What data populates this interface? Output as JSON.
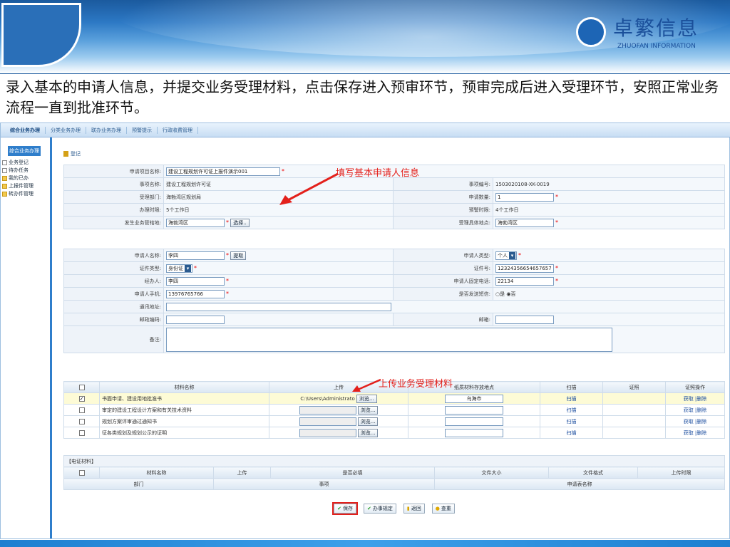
{
  "header": {
    "brand_name": "卓繁信息",
    "brand_sub": "ZHUOFAN INFORMATION"
  },
  "description": "录入基本的申请人信息，并提交业务受理材料，点击保存进入预审环节，预审完成后进入受理环节，安照正常业务流程一直到批准环节。",
  "menubar": [
    "综合业务办理",
    "分类业务办理",
    "联办业务办理",
    "预警提示",
    "行政收费管理"
  ],
  "sidebar": {
    "head": "综合业务办理",
    "items": [
      "业务登记",
      "待办任务",
      "我的已办",
      "上报件管理",
      "转办件管理"
    ]
  },
  "crumb": "登记",
  "annotations": {
    "fill_info": "填写基本申请人信息",
    "upload": "上传业务受理材料"
  },
  "form1": {
    "project_name_label": "申请项目名称:",
    "project_name_value": "建设工程规划许可证上报件演示001",
    "matter_name_label": "事项名称:",
    "matter_name_value": "建设工程规划许可证",
    "matter_no_label": "事项编号:",
    "matter_no_value": "1503020108-XK-0019",
    "dept_label": "受理部门:",
    "dept_value": "海勃湾区规划局",
    "qty_label": "申请数量:",
    "qty_value": "1",
    "time_label": "办理时限:",
    "time_value": "5个工作日",
    "warn_label": "预警时限:",
    "warn_value": "4个工作日",
    "area_label": "发生业务管辖地:",
    "area_value": "海勃湾区",
    "choose_button": "选择..",
    "place_label": "受理具体地点:",
    "place_value": "海勃湾区"
  },
  "form2": {
    "applicant_label": "申请人名称:",
    "applicant_value": "李四",
    "pick_button": "提取",
    "type_label": "申请人类型:",
    "type_value": "个人",
    "idtype_label": "证件类型:",
    "idtype_value": "身份证",
    "idno_label": "证件号:",
    "idno_value": "12324356654657657",
    "agent_label": "经办人:",
    "agent_value": "李四",
    "phone_label": "申请人固定电话:",
    "phone_value": "22134",
    "mobile_label": "申请人手机:",
    "mobile_value": "13976765766",
    "sms_label": "是否发送短信:",
    "sms_options": "○是 ◉否",
    "addr_label": "通讯地址:",
    "zip_label": "邮政编码:",
    "email_label": "邮箱:",
    "note_label": "备注:"
  },
  "materials": {
    "headers": [
      "材料名称",
      "上传",
      "纸质材料存放地点",
      "扫描",
      "证照",
      "证照操作"
    ],
    "rows": [
      {
        "name": "书面申请、建设用地批准书",
        "path": "C:\\Users\\Administrato",
        "place": "乌海市",
        "scan": "扫描",
        "ops": "获取 |删除",
        "checked": true
      },
      {
        "name": "审定的建设工程设计方案和有关技术资料",
        "path": "",
        "place": "",
        "scan": "扫描",
        "ops": "获取 |删除",
        "checked": false
      },
      {
        "name": "规划方案评审通过通知书",
        "path": "",
        "place": "",
        "scan": "扫描",
        "ops": "获取 |删除",
        "checked": false
      },
      {
        "name": "征各类规划及规划公示的证明",
        "path": "",
        "place": "",
        "scan": "扫描",
        "ops": "获取 |删除",
        "checked": false
      }
    ],
    "browse_label": "浏览..."
  },
  "electronic": {
    "title": "【电证材料】",
    "headers": [
      "材料名称",
      "上传",
      "是否必填",
      "文件大小",
      "文件格式",
      "上传时限"
    ],
    "sub_headers": [
      "部门",
      "事项",
      "申请表名称"
    ]
  },
  "actions": [
    "保存",
    "办事规定",
    "返回",
    "查重"
  ],
  "colors": {
    "accent": "#2f7ecb",
    "annotation": "#e3201b",
    "banner": "#1b5a9e"
  }
}
